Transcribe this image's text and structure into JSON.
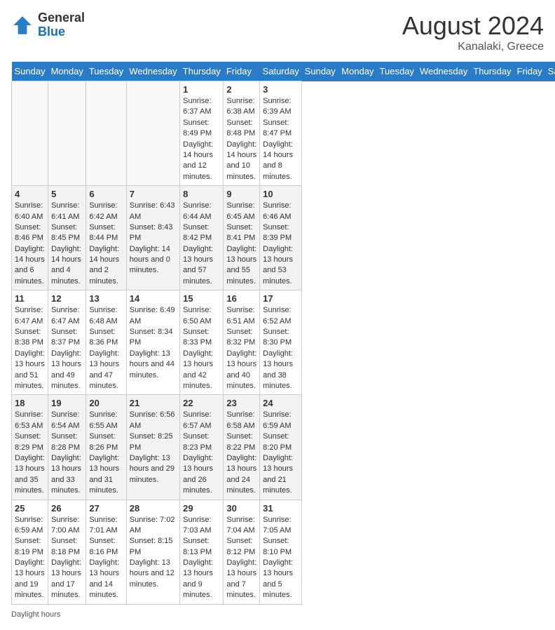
{
  "logo": {
    "general": "General",
    "blue": "Blue"
  },
  "title": "August 2024",
  "location": "Kanalaki, Greece",
  "days_of_week": [
    "Sunday",
    "Monday",
    "Tuesday",
    "Wednesday",
    "Thursday",
    "Friday",
    "Saturday"
  ],
  "footer": "Daylight hours",
  "weeks": [
    [
      {
        "day": "",
        "empty": true
      },
      {
        "day": "",
        "empty": true
      },
      {
        "day": "",
        "empty": true
      },
      {
        "day": "",
        "empty": true
      },
      {
        "day": "1",
        "sunrise": "6:37 AM",
        "sunset": "8:49 PM",
        "daylight": "14 hours and 12 minutes."
      },
      {
        "day": "2",
        "sunrise": "6:38 AM",
        "sunset": "8:48 PM",
        "daylight": "14 hours and 10 minutes."
      },
      {
        "day": "3",
        "sunrise": "6:39 AM",
        "sunset": "8:47 PM",
        "daylight": "14 hours and 8 minutes."
      }
    ],
    [
      {
        "day": "4",
        "sunrise": "6:40 AM",
        "sunset": "8:46 PM",
        "daylight": "14 hours and 6 minutes."
      },
      {
        "day": "5",
        "sunrise": "6:41 AM",
        "sunset": "8:45 PM",
        "daylight": "14 hours and 4 minutes."
      },
      {
        "day": "6",
        "sunrise": "6:42 AM",
        "sunset": "8:44 PM",
        "daylight": "14 hours and 2 minutes."
      },
      {
        "day": "7",
        "sunrise": "6:43 AM",
        "sunset": "8:43 PM",
        "daylight": "14 hours and 0 minutes."
      },
      {
        "day": "8",
        "sunrise": "6:44 AM",
        "sunset": "8:42 PM",
        "daylight": "13 hours and 57 minutes."
      },
      {
        "day": "9",
        "sunrise": "6:45 AM",
        "sunset": "8:41 PM",
        "daylight": "13 hours and 55 minutes."
      },
      {
        "day": "10",
        "sunrise": "6:46 AM",
        "sunset": "8:39 PM",
        "daylight": "13 hours and 53 minutes."
      }
    ],
    [
      {
        "day": "11",
        "sunrise": "6:47 AM",
        "sunset": "8:38 PM",
        "daylight": "13 hours and 51 minutes."
      },
      {
        "day": "12",
        "sunrise": "6:47 AM",
        "sunset": "8:37 PM",
        "daylight": "13 hours and 49 minutes."
      },
      {
        "day": "13",
        "sunrise": "6:48 AM",
        "sunset": "8:36 PM",
        "daylight": "13 hours and 47 minutes."
      },
      {
        "day": "14",
        "sunrise": "6:49 AM",
        "sunset": "8:34 PM",
        "daylight": "13 hours and 44 minutes."
      },
      {
        "day": "15",
        "sunrise": "6:50 AM",
        "sunset": "8:33 PM",
        "daylight": "13 hours and 42 minutes."
      },
      {
        "day": "16",
        "sunrise": "6:51 AM",
        "sunset": "8:32 PM",
        "daylight": "13 hours and 40 minutes."
      },
      {
        "day": "17",
        "sunrise": "6:52 AM",
        "sunset": "8:30 PM",
        "daylight": "13 hours and 38 minutes."
      }
    ],
    [
      {
        "day": "18",
        "sunrise": "6:53 AM",
        "sunset": "8:29 PM",
        "daylight": "13 hours and 35 minutes."
      },
      {
        "day": "19",
        "sunrise": "6:54 AM",
        "sunset": "8:28 PM",
        "daylight": "13 hours and 33 minutes."
      },
      {
        "day": "20",
        "sunrise": "6:55 AM",
        "sunset": "8:26 PM",
        "daylight": "13 hours and 31 minutes."
      },
      {
        "day": "21",
        "sunrise": "6:56 AM",
        "sunset": "8:25 PM",
        "daylight": "13 hours and 29 minutes."
      },
      {
        "day": "22",
        "sunrise": "6:57 AM",
        "sunset": "8:23 PM",
        "daylight": "13 hours and 26 minutes."
      },
      {
        "day": "23",
        "sunrise": "6:58 AM",
        "sunset": "8:22 PM",
        "daylight": "13 hours and 24 minutes."
      },
      {
        "day": "24",
        "sunrise": "6:59 AM",
        "sunset": "8:20 PM",
        "daylight": "13 hours and 21 minutes."
      }
    ],
    [
      {
        "day": "25",
        "sunrise": "6:59 AM",
        "sunset": "8:19 PM",
        "daylight": "13 hours and 19 minutes."
      },
      {
        "day": "26",
        "sunrise": "7:00 AM",
        "sunset": "8:18 PM",
        "daylight": "13 hours and 17 minutes."
      },
      {
        "day": "27",
        "sunrise": "7:01 AM",
        "sunset": "8:16 PM",
        "daylight": "13 hours and 14 minutes."
      },
      {
        "day": "28",
        "sunrise": "7:02 AM",
        "sunset": "8:15 PM",
        "daylight": "13 hours and 12 minutes."
      },
      {
        "day": "29",
        "sunrise": "7:03 AM",
        "sunset": "8:13 PM",
        "daylight": "13 hours and 9 minutes."
      },
      {
        "day": "30",
        "sunrise": "7:04 AM",
        "sunset": "8:12 PM",
        "daylight": "13 hours and 7 minutes."
      },
      {
        "day": "31",
        "sunrise": "7:05 AM",
        "sunset": "8:10 PM",
        "daylight": "13 hours and 5 minutes."
      }
    ]
  ]
}
